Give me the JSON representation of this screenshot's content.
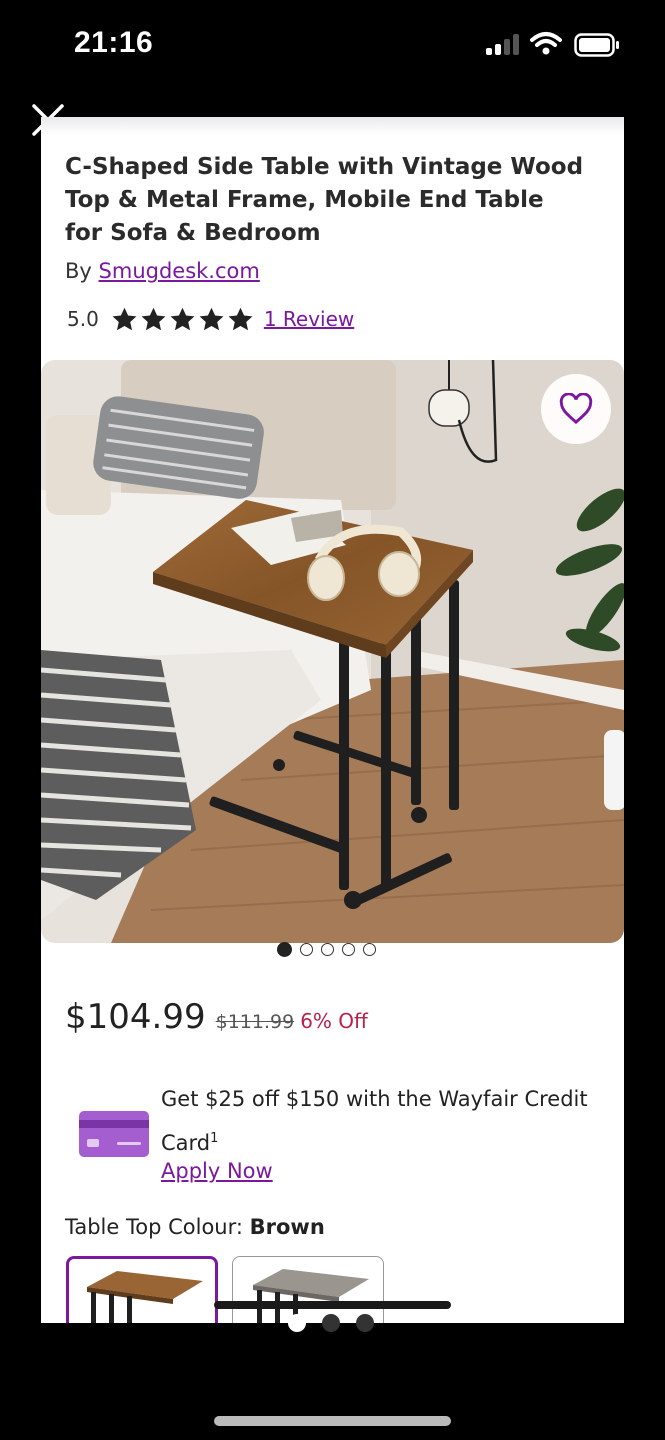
{
  "status_bar": {
    "time": "21:16"
  },
  "product": {
    "title": "C-Shaped Side Table with Vintage Wood Top & Metal Frame, Mobile End Table for Sofa & Bedroom",
    "by_prefix": "By",
    "brand": "Smugdesk.com",
    "rating": "5.0",
    "stars": 5,
    "review_link": "1 Review",
    "image_dots": 5,
    "image_active_index": 0
  },
  "pricing": {
    "price": "$104.99",
    "original_price": "$111.99",
    "discount": "6% Off"
  },
  "credit_offer": {
    "text": "Get $25 off $150 with the Wayfair Credit Card",
    "footnote": "1",
    "apply_link": "Apply Now"
  },
  "options": {
    "colour_label": "Table Top Colour:",
    "colour_value": "Brown",
    "swatches": [
      {
        "name": "Brown",
        "selected": true
      },
      {
        "name": "Grey",
        "selected": false
      }
    ]
  },
  "colors": {
    "accent": "#7b189f",
    "discount": "#b8224a",
    "card_purple": "#a45ed0"
  },
  "icons": [
    "close-icon",
    "heart-icon",
    "star-icon",
    "credit-card-icon",
    "signal-icon",
    "wifi-icon",
    "battery-icon"
  ]
}
